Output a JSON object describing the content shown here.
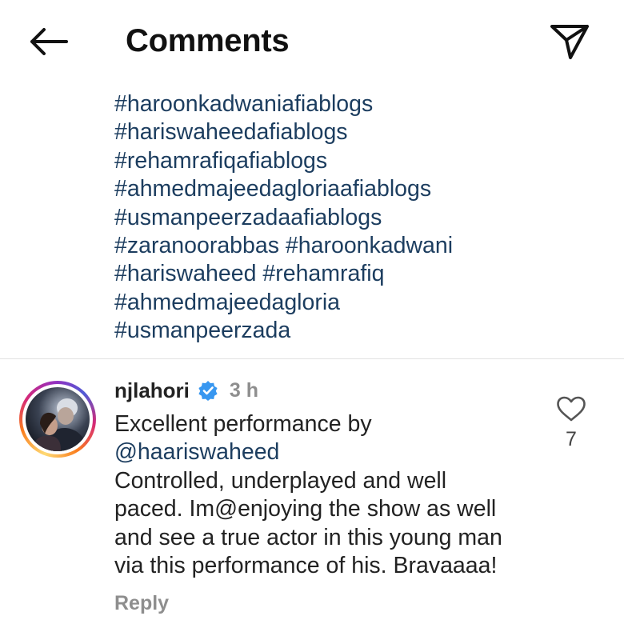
{
  "header": {
    "title": "Comments",
    "back_icon": "arrow-left-icon",
    "share_icon": "paper-plane-icon"
  },
  "hashtag_lines": [
    [
      "#haroonkadwaniafiablogs"
    ],
    [
      "#hariswaheedafiablogs"
    ],
    [
      "#rehamrafiqafiablogs"
    ],
    [
      "#ahmedmajeedagloriaafiablogs"
    ],
    [
      "#usmanpeerzadaafiablogs"
    ],
    [
      "#zaranoorabbas",
      "#haroonkadwani"
    ],
    [
      "#hariswaheed",
      "#rehamrafiq"
    ],
    [
      "#ahmedmajeedagloria"
    ],
    [
      "#usmanpeerzada"
    ]
  ],
  "comment": {
    "username": "njlahori",
    "verified_icon": "verified-badge-icon",
    "time": "3 h",
    "text_line1": "Excellent performance by",
    "mention": "@haariswaheed",
    "text_lines": [
      "Controlled, underplayed and well",
      "paced. Im@enjoying the show as well",
      "and see a true actor in this young man",
      "via this performance of his. Bravaaaa!"
    ],
    "reply_label": "Reply",
    "like_icon": "heart-icon",
    "like_count": "7"
  },
  "colors": {
    "link": "#1c3d5f",
    "text": "#222222",
    "muted": "#8e8e8e",
    "verified": "#3897f0",
    "divider": "#e2e2e2"
  }
}
